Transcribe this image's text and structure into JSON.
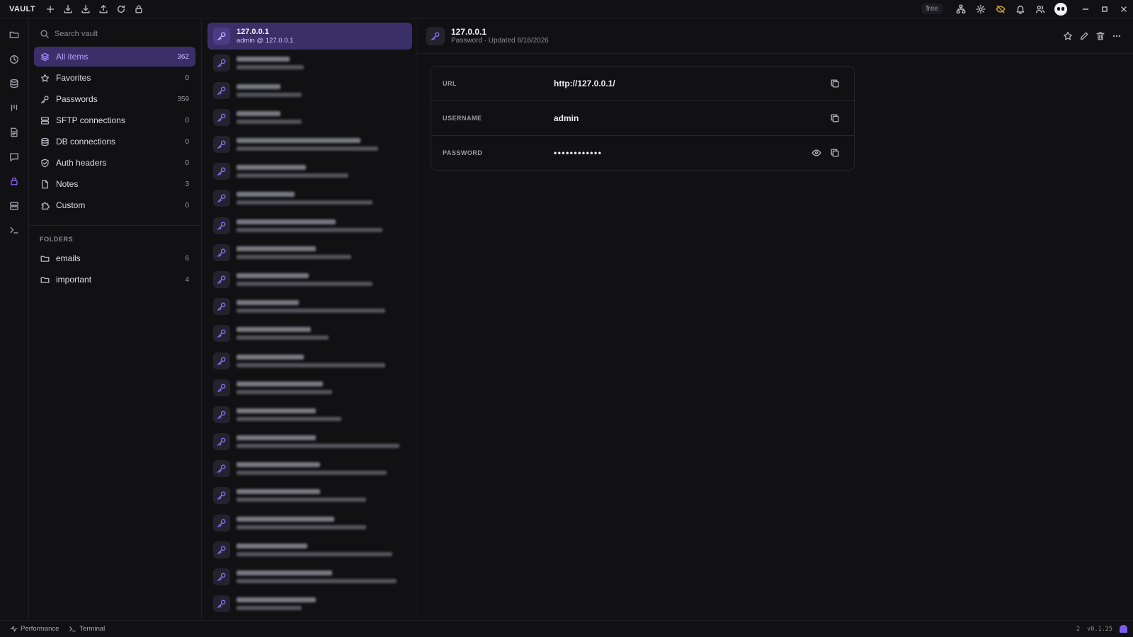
{
  "app": {
    "title": "VAULT"
  },
  "topbar": {
    "plan_badge": "free"
  },
  "sidebar": {
    "search_placeholder": "Search vault",
    "items": [
      {
        "label": "All items",
        "count": "362",
        "icon": "layers-icon",
        "active": true
      },
      {
        "label": "Favorites",
        "count": "0",
        "icon": "star-icon"
      },
      {
        "label": "Passwords",
        "count": "359",
        "icon": "key-icon"
      },
      {
        "label": "SFTP connections",
        "count": "0",
        "icon": "server-icon"
      },
      {
        "label": "DB connections",
        "count": "0",
        "icon": "database-icon"
      },
      {
        "label": "Auth headers",
        "count": "0",
        "icon": "shield-icon"
      },
      {
        "label": "Notes",
        "count": "3",
        "icon": "file-icon"
      },
      {
        "label": "Custom",
        "count": "0",
        "icon": "puzzle-icon"
      }
    ],
    "folders_header": "FOLDERS",
    "folders": [
      {
        "label": "emails",
        "count": "6"
      },
      {
        "label": "important",
        "count": "4"
      }
    ]
  },
  "list": {
    "selected": {
      "title": "127.0.0.1",
      "subtitle": "admin @ 127.0.0.1"
    }
  },
  "detail": {
    "title": "127.0.0.1",
    "subtitle": "Password · Updated 8/18/2026",
    "fields": [
      {
        "label": "URL",
        "value": "http://127.0.0.1/"
      },
      {
        "label": "USERNAME",
        "value": "admin"
      },
      {
        "label": "PASSWORD",
        "value": "••••••••••••"
      }
    ]
  },
  "statusbar": {
    "performance": "Performance",
    "terminal": "Terminal",
    "count": "2",
    "version": "v0.1.25"
  }
}
